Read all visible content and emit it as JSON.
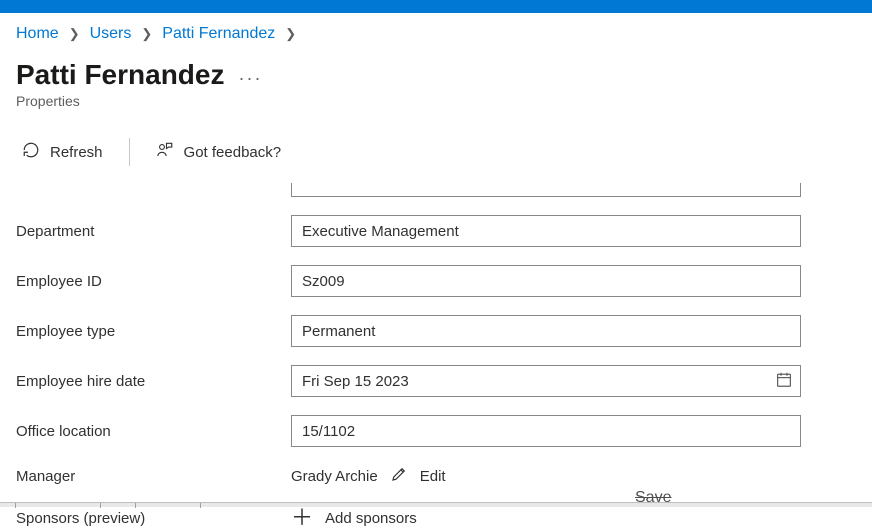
{
  "breadcrumb": {
    "home": "Home",
    "users": "Users",
    "current": "Patti Fernandez"
  },
  "header": {
    "title": "Patti Fernandez",
    "subtitle": "Properties"
  },
  "toolbar": {
    "refresh": "Refresh",
    "feedback": "Got feedback?"
  },
  "fields": {
    "department": {
      "label": "Department",
      "value": "Executive Management"
    },
    "employee_id": {
      "label": "Employee ID",
      "value": "Sz009"
    },
    "employee_type": {
      "label": "Employee type",
      "value": "Permanent"
    },
    "hire_date": {
      "label": "Employee hire date",
      "value": "Fri Sep 15 2023"
    },
    "office_location": {
      "label": "Office location",
      "value": "15/1102"
    },
    "manager": {
      "label": "Manager",
      "value": "Grady Archie",
      "edit": "Edit"
    },
    "sponsors": {
      "label": "Sponsors (preview)",
      "add": "Add sponsors"
    }
  },
  "footer": {
    "save": "Save"
  }
}
